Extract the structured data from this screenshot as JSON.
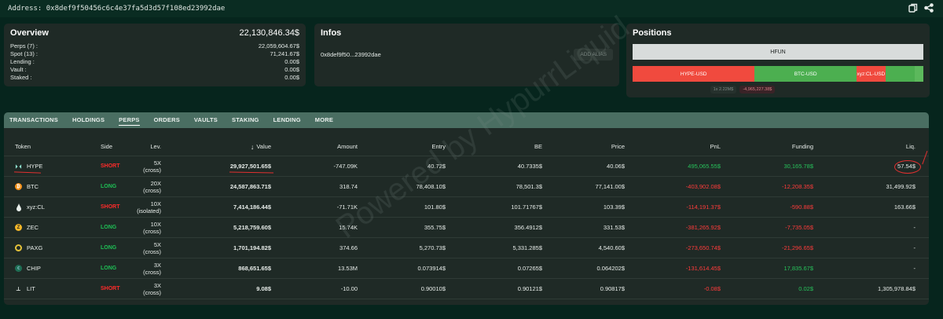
{
  "header": {
    "address_label": "Address: 0x8def9f50456c6c4e37fa5d3d57f108ed23992dae",
    "icons": [
      "copy-icon",
      "share-icon"
    ]
  },
  "overview": {
    "title": "Overview",
    "total": "22,130,846.34$",
    "rows": [
      {
        "label": "Perps (7) :",
        "value": "22,059,604.67$"
      },
      {
        "label": "Spot (13) :",
        "value": "71,241.67$"
      },
      {
        "label": "Lending :",
        "value": "0.00$"
      },
      {
        "label": "Vault :",
        "value": "0.00$"
      },
      {
        "label": "Staked :",
        "value": "0.00$"
      }
    ]
  },
  "infos": {
    "title": "Infos",
    "address_short": "0x8def9f50...23992dae",
    "alias_button": "ADD ALIAS"
  },
  "positions": {
    "title": "Positions",
    "hfun_label": "HFUN",
    "bar": [
      {
        "label": "HYPE-USD",
        "share": 0.42,
        "color": "#f04a3e"
      },
      {
        "label": "BTC-USD",
        "share": 0.35,
        "color": "#4caf50"
      },
      {
        "label": "xyz:CL-USD",
        "share": 0.1,
        "color": "#f04a3e"
      },
      {
        "label": "",
        "share": 0.1,
        "color": "#4caf50"
      },
      {
        "label": "",
        "share": 0.03,
        "color": "#5cb85c"
      }
    ],
    "foot_long": "1x 2.22M$",
    "foot_short": "-4,965,227.38$"
  },
  "tabs": [
    "TRANSACTIONS",
    "HOLDINGS",
    "PERPS",
    "ORDERS",
    "VAULTS",
    "STAKING",
    "LENDING",
    "MORE"
  ],
  "active_tab": "PERPS",
  "table": {
    "headers": [
      "Token",
      "Side",
      "Lev.",
      "Value",
      "Amount",
      "Entry",
      "BE",
      "Price",
      "PnL",
      "Funding",
      "Liq."
    ],
    "value_sort_arrow": "↓",
    "rows": [
      {
        "token": "HYPE",
        "icon": "hype-icon",
        "side": "SHORT",
        "lev1": "5X",
        "lev2": "(cross)",
        "value": "29,927,501.65$",
        "amount": "-747.09K",
        "entry": "40.72$",
        "be": "40.7335$",
        "price": "40.06$",
        "pnl": "495,065.55$",
        "pnl_sign": "pos",
        "funding": "30,165.78$",
        "funding_sign": "pos",
        "liq": "57.54$"
      },
      {
        "token": "BTC",
        "icon": "btc-icon",
        "side": "LONG",
        "lev1": "20X",
        "lev2": "(cross)",
        "value": "24,587,863.71$",
        "amount": "318.74",
        "entry": "78,408.10$",
        "be": "78,501.3$",
        "price": "77,141.00$",
        "pnl": "-403,902.08$",
        "pnl_sign": "neg",
        "funding": "-12,208.35$",
        "funding_sign": "neg",
        "liq": "31,499.92$"
      },
      {
        "token": "xyz:CL",
        "icon": "oil-drop-icon",
        "side": "SHORT",
        "lev1": "10X",
        "lev2": "(isolated)",
        "value": "7,414,186.44$",
        "amount": "-71.71K",
        "entry": "101.80$",
        "be": "101.71767$",
        "price": "103.39$",
        "pnl": "-114,191.37$",
        "pnl_sign": "neg",
        "funding": "-590.88$",
        "funding_sign": "neg",
        "liq": "163.66$"
      },
      {
        "token": "ZEC",
        "icon": "zec-icon",
        "side": "LONG",
        "lev1": "10X",
        "lev2": "(cross)",
        "value": "5,218,759.60$",
        "amount": "15.74K",
        "entry": "355.75$",
        "be": "356.4912$",
        "price": "331.53$",
        "pnl": "-381,265.92$",
        "pnl_sign": "neg",
        "funding": "-7,735.05$",
        "funding_sign": "neg",
        "liq": "-"
      },
      {
        "token": "PAXG",
        "icon": "paxg-icon",
        "side": "LONG",
        "lev1": "5X",
        "lev2": "(cross)",
        "value": "1,701,194.82$",
        "amount": "374.66",
        "entry": "5,270.73$",
        "be": "5,331.285$",
        "price": "4,540.60$",
        "pnl": "-273,650.74$",
        "pnl_sign": "neg",
        "funding": "-21,296.65$",
        "funding_sign": "neg",
        "liq": "-"
      },
      {
        "token": "CHIP",
        "icon": "chip-icon",
        "side": "LONG",
        "lev1": "3X",
        "lev2": "(cross)",
        "value": "868,651.65$",
        "amount": "13.53M",
        "entry": "0.073914$",
        "be": "0.07265$",
        "price": "0.064202$",
        "pnl": "-131,614.45$",
        "pnl_sign": "neg",
        "funding": "17,835.67$",
        "funding_sign": "pos",
        "liq": "-"
      },
      {
        "token": "LIT",
        "icon": "lit-icon",
        "side": "SHORT",
        "lev1": "3X",
        "lev2": "(cross)",
        "value": "9.08$",
        "amount": "-10.00",
        "entry": "0.90010$",
        "be": "0.90121$",
        "price": "0.90817$",
        "pnl": "-0.08$",
        "pnl_sign": "neg",
        "funding": "0.02$",
        "funding_sign": "pos",
        "liq": "1,305,978.84$"
      }
    ]
  },
  "watermark": "Powered by HypurrLiquid"
}
